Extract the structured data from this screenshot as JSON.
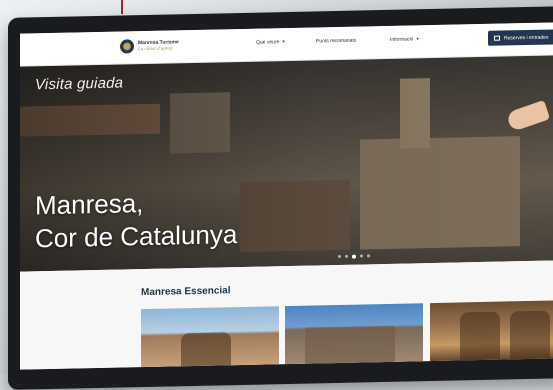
{
  "navbar": {
    "logo": {
      "name": "Manresa Turisme",
      "tagline": "La ciutat d'aprop",
      "icon": "logo-seal-icon"
    },
    "menu": [
      {
        "label": "Què veure",
        "chevron": "▾"
      },
      {
        "label": "Punts recomanats",
        "chevron": ""
      },
      {
        "label": "Informació",
        "chevron": "▾"
      }
    ],
    "cta": {
      "label": "Reserves i entrades",
      "icon": "ticket-icon"
    }
  },
  "hero": {
    "kicker": "Visita guiada",
    "title_line1": "Manresa,",
    "title_line2": "Cor de Catalunya",
    "slides_total": 5,
    "slide_active": 3
  },
  "section": {
    "title": "Manresa Essencial",
    "cards": [
      {
        "name": "basilica"
      },
      {
        "name": "old-town"
      },
      {
        "name": "cave-interior"
      }
    ]
  },
  "colors": {
    "navy": "#23364f",
    "gold": "#b8913e",
    "accent_line": "#b01d2e"
  }
}
